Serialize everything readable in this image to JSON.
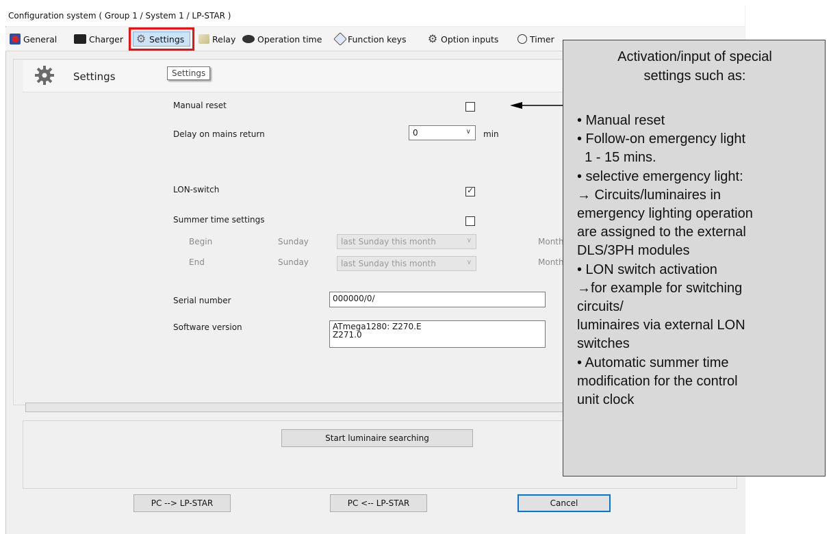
{
  "window": {
    "title": "Configuration system ( Group 1 / System 1 / LP-STAR )"
  },
  "toolbar": {
    "items": [
      {
        "label": "General",
        "icon": "general-icon"
      },
      {
        "label": "Charger",
        "icon": "battery-icon"
      },
      {
        "label": "Settings",
        "icon": "gear-icon"
      },
      {
        "label": "Relay",
        "icon": "relay-icon"
      },
      {
        "label": "Operation time",
        "icon": "operation-time-icon"
      },
      {
        "label": "Function keys",
        "icon": "function-keys-icon"
      },
      {
        "label": "Option inputs",
        "icon": "option-inputs-icon"
      },
      {
        "label": "Timer",
        "icon": "clock-icon"
      }
    ]
  },
  "header": {
    "title": "Settings",
    "tooltip": "Settings"
  },
  "form": {
    "manual_reset": {
      "label": "Manual reset",
      "checked": false
    },
    "delay": {
      "label": "Delay on mains return",
      "value": "0",
      "unit": "min"
    },
    "lon_switch": {
      "label": "LON-switch",
      "checked": true
    },
    "summer_time": {
      "label": "Summer time settings",
      "checked": false,
      "begin": {
        "label": "Begin",
        "day": "Sunday",
        "option": "last Sunday this month",
        "month_label": "Month"
      },
      "end": {
        "label": "End",
        "day": "Sunday",
        "option": "last Sunday this month",
        "month_label": "Month"
      }
    },
    "serial": {
      "label": "Serial number",
      "value": "000000/0/"
    },
    "software": {
      "label": "Software version",
      "value_line1": "ATmega1280: Z270.E",
      "value_line2": "Z271.0"
    }
  },
  "actions": {
    "search_label": "Start luminaire searching",
    "pc_to_device": "PC --> LP-STAR",
    "device_to_pc": "PC <-- LP-STAR",
    "cancel": "Cancel"
  },
  "callout": {
    "title_line1": "Activation/input of special",
    "title_line2": "settings such as:",
    "lines": [
      "• Manual reset",
      "• Follow-on emergency light",
      "  1 - 15 mins.",
      "• selective emergency light:",
      "→ Circuits/luminaires in",
      "emergency lighting operation",
      "are assigned to the external",
      "DLS/3PH modules",
      "• LON switch activation",
      "→for example for switching",
      "circuits/",
      "luminaires via external LON",
      "switches",
      "• Automatic summer time",
      "modification for the control",
      "unit clock"
    ]
  }
}
